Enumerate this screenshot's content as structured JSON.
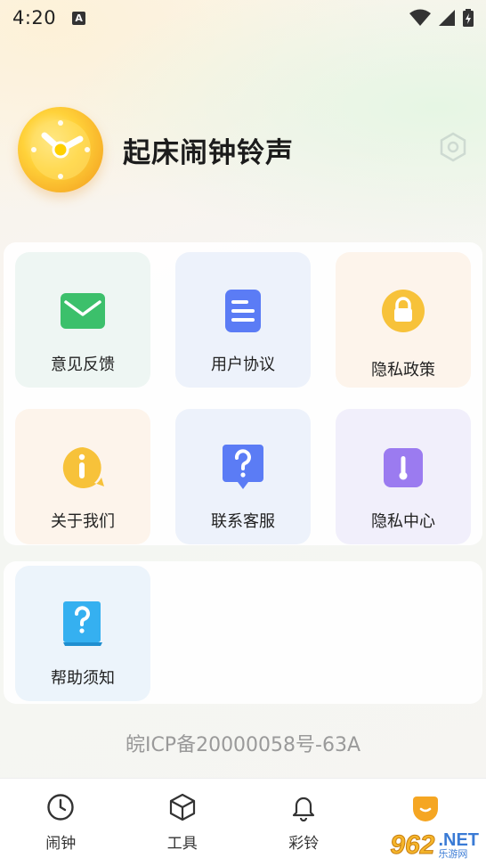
{
  "status_bar": {
    "time": "4:20",
    "notification_letter": "A"
  },
  "profile": {
    "app_title": "起床闹钟铃声",
    "avatar_icon": "clock-icon",
    "settings_icon": "settings-icon"
  },
  "menu": [
    {
      "label": "意见反馈",
      "icon": "mail-icon",
      "color": "#3cc06b"
    },
    {
      "label": "用户协议",
      "icon": "document-icon",
      "color": "#5b7cf5"
    },
    {
      "label": "隐私政策",
      "icon": "lock-icon",
      "color": "#f7c23a"
    },
    {
      "label": "关于我们",
      "icon": "info-icon",
      "color": "#f7c23a"
    },
    {
      "label": "联系客服",
      "icon": "question-bubble-icon",
      "color": "#5b7cf5"
    },
    {
      "label": "隐私中心",
      "icon": "thermometer-icon",
      "color": "#9b7bf0"
    },
    {
      "label": "帮助须知",
      "icon": "help-book-icon",
      "color": "#35b0f0"
    }
  ],
  "icp": "皖ICP备20000058号-63A",
  "bottom_nav": [
    {
      "label": "闹钟",
      "icon": "clock-icon"
    },
    {
      "label": "工具",
      "icon": "box-icon"
    },
    {
      "label": "彩铃",
      "icon": "bell-icon"
    },
    {
      "label": "",
      "icon": "profile-icon",
      "active_color": "#f5a623"
    }
  ],
  "watermark": {
    "number": "962",
    "domain": ".NET",
    "subtitle": "乐游网"
  }
}
